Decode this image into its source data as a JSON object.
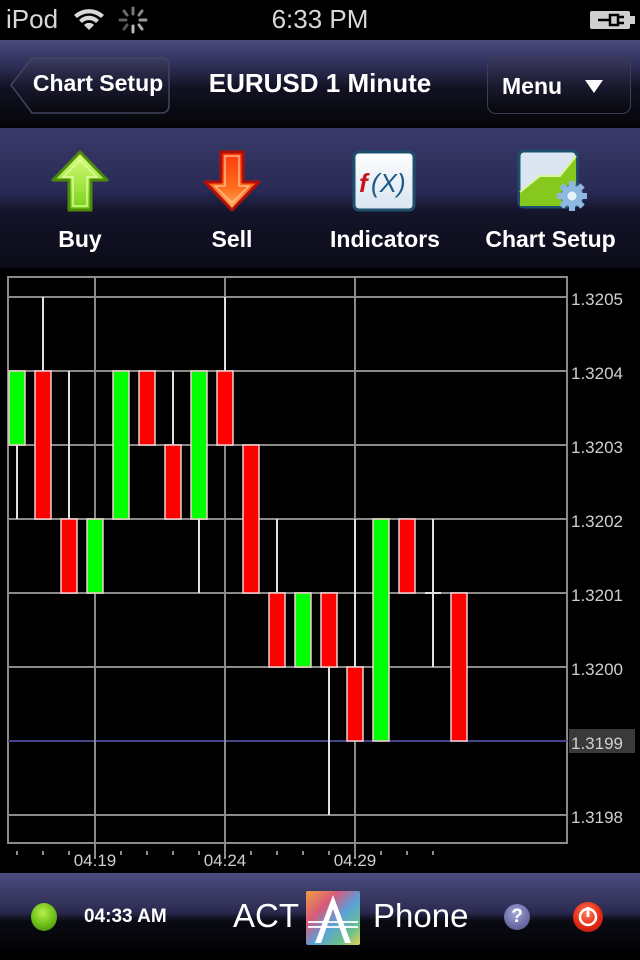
{
  "status_bar": {
    "carrier": "iPod",
    "time": "6:33 PM",
    "icons": [
      "wifi-icon",
      "activity-spinner-icon",
      "battery-charging-icon"
    ]
  },
  "nav_bar": {
    "back_label": "Chart Setup",
    "title": "EURUSD 1 Minute",
    "menu_label": "Menu",
    "menu_icon": "triangle-down-icon"
  },
  "toolbar": {
    "items": [
      {
        "label": "Buy",
        "icon": "green-up-arrow-icon"
      },
      {
        "label": "Sell",
        "icon": "red-down-arrow-icon"
      },
      {
        "label": "Indicators",
        "icon": "function-fx-icon",
        "icon_text": "f(X)"
      },
      {
        "label": "Chart Setup",
        "icon": "chart-settings-icon"
      }
    ]
  },
  "colors": {
    "up": "#00ff00",
    "down": "#ff0000",
    "grid": "#8a8a8a",
    "current_price_line": "#45458a",
    "background": "#000000"
  },
  "chart_data": {
    "type": "candlestick",
    "symbol": "EURUSD",
    "timeframe": "1 Minute",
    "ylim": [
      1.31973,
      1.32053
    ],
    "y_ticks": [
      "1.3205",
      "1.3204",
      "1.3203",
      "1.3202",
      "1.3201",
      "1.3200",
      "1.3199",
      "1.3198"
    ],
    "y_tick_values": [
      1.3205,
      1.3204,
      1.3203,
      1.3202,
      1.3201,
      1.32,
      1.3199,
      1.3198
    ],
    "x_labels": [
      {
        "index": 3,
        "label": "04:19"
      },
      {
        "index": 8,
        "label": "04:24"
      },
      {
        "index": 13,
        "label": "04:29"
      }
    ],
    "x_minor_tick_count": 17,
    "current_price": 1.3199,
    "current_price_label": "1.3199",
    "grid": true,
    "candles": [
      {
        "o": 1.3203,
        "h": 1.3204,
        "l": 1.3202,
        "c": 1.3204
      },
      {
        "o": 1.3204,
        "h": 1.3205,
        "l": 1.3202,
        "c": 1.3202
      },
      {
        "o": 1.3202,
        "h": 1.3204,
        "l": 1.3201,
        "c": 1.3201
      },
      {
        "o": 1.3201,
        "h": 1.3202,
        "l": 1.3201,
        "c": 1.3202
      },
      {
        "o": 1.3202,
        "h": 1.3204,
        "l": 1.3202,
        "c": 1.3204
      },
      {
        "o": 1.3204,
        "h": 1.3204,
        "l": 1.3203,
        "c": 1.3203
      },
      {
        "o": 1.3203,
        "h": 1.3204,
        "l": 1.3202,
        "c": 1.3202
      },
      {
        "o": 1.3202,
        "h": 1.3204,
        "l": 1.3201,
        "c": 1.3204
      },
      {
        "o": 1.3204,
        "h": 1.3205,
        "l": 1.3203,
        "c": 1.3203
      },
      {
        "o": 1.3203,
        "h": 1.3203,
        "l": 1.3201,
        "c": 1.3201
      },
      {
        "o": 1.3201,
        "h": 1.3202,
        "l": 1.32,
        "c": 1.32
      },
      {
        "o": 1.32,
        "h": 1.3201,
        "l": 1.32,
        "c": 1.3201
      },
      {
        "o": 1.3201,
        "h": 1.3201,
        "l": 1.3198,
        "c": 1.32
      },
      {
        "o": 1.32,
        "h": 1.3202,
        "l": 1.3199,
        "c": 1.3199
      },
      {
        "o": 1.3199,
        "h": 1.3202,
        "l": 1.3199,
        "c": 1.3202
      },
      {
        "o": 1.3202,
        "h": 1.3202,
        "l": 1.3201,
        "c": 1.3201
      },
      {
        "o": 1.3201,
        "h": 1.3202,
        "l": 1.32,
        "c": 1.3201
      },
      {
        "o": 1.3201,
        "h": 1.3201,
        "l": 1.3199,
        "c": 1.3199
      }
    ]
  },
  "footer": {
    "connection_status": "connected",
    "time": "04:33 AM",
    "brand_left": "ACT",
    "brand_right": "Phone",
    "help_symbol": "?",
    "icons": [
      "connection-status-icon",
      "act-logo-icon",
      "help-icon",
      "power-icon"
    ]
  }
}
